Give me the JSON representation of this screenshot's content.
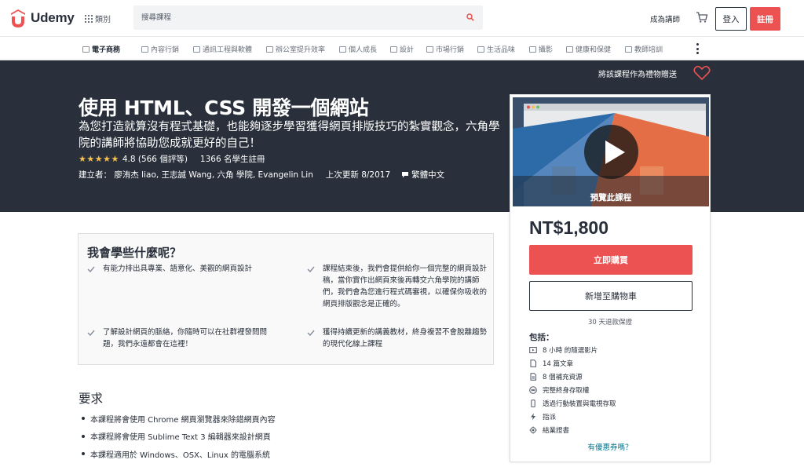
{
  "header": {
    "logo_text": "Udemy",
    "categories_label": "類別",
    "search_placeholder": "搜尋課程",
    "teach_label": "成為講師",
    "login_label": "登入",
    "signup_label": "註冊"
  },
  "catbar": {
    "items": [
      "電子商務",
      "內容行銷",
      "通訊工程與軟體",
      "辦公室提升效率",
      "個人成長",
      "設計",
      "市場行銷",
      "生活品味",
      "攝影",
      "健康和保健",
      "教師培訓"
    ]
  },
  "course": {
    "gift_label": "將該課程作為禮物贈送",
    "title": "使用 HTML、CSS 開發一個網站",
    "subtitle": "為您打造就算沒有程式基礎，也能夠逐步學習獲得網頁排版技巧的紮實觀念，六角學院的講師將協助您成就更好的自己！",
    "stars": "★★★★★",
    "rating": "4.8 (566 個評等)",
    "students": "1366 名學生註冊",
    "instructors": "建立者： 廖洧杰 liao, 王志誠 Wang, 六角 學院, Evangelin Lin",
    "updated": "上次更新 8/2017",
    "language": "繁體中文"
  },
  "sidebar": {
    "preview_label": "預覽此課程",
    "price": "NT$1,800",
    "buy_label": "立即購買",
    "cart_label": "新增至購物車",
    "guarantee": "30 天退款保證",
    "includes_title": "包括：",
    "includes": [
      {
        "icon": "video-icon",
        "text": "8 小時 的隨選影片"
      },
      {
        "icon": "article-icon",
        "text": "14 篇文章"
      },
      {
        "icon": "resource-icon",
        "text": "8 個補充資源"
      },
      {
        "icon": "infinity-icon",
        "text": "完整終身存取權"
      },
      {
        "icon": "mobile-icon",
        "text": "透過行動裝置與電視存取"
      },
      {
        "icon": "lightning-icon",
        "text": "指派"
      },
      {
        "icon": "certificate-icon",
        "text": "結業證書"
      }
    ],
    "coupon_label": "有優惠券嗎？"
  },
  "learn": {
    "title": "我會學些什麼呢？",
    "items": [
      "有能力排出具專業、語意化、美觀的網頁設計",
      "課程結束後，我們會提供給你一個完整的網頁設計稿，當你實作出網頁來後再轉交六角學院的講師們，我們會為您進行程式碼審視，以確保你吸收的網頁排版觀念是正確的。",
      "了解設計網頁的脈絡，你隨時可以在社群裡發問問題，我們永遠都會在這裡！",
      "獲得持續更新的講義教材，終身複習不會脫離趨勢的現代化線上課程"
    ]
  },
  "requirements": {
    "title": "要求",
    "items": [
      "本課程將會使用 Chrome 網頁瀏覽器來除錯網頁內容",
      "本課程將會使用 Sublime Text 3 編輯器來設計網頁",
      "本課程適用於 Windows、OSX、Linux 的電腦系統"
    ]
  },
  "colors": {
    "brand_red": "#ec5252",
    "dark_banner": "#29303b",
    "star_yellow": "#f4c150",
    "link_blue": "#007791"
  }
}
